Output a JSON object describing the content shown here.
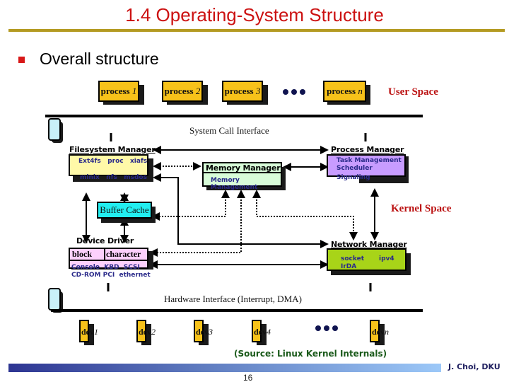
{
  "slide": {
    "title": "1.4 Operating-System Structure",
    "bullet": "Overall structure",
    "source": "(Source: Linux Kernel Internals)",
    "author": "J. Choi, DKU",
    "page_number": "16"
  },
  "colors": {
    "title": "#cc1111",
    "title_rule": "#b49a22",
    "process_box": "#f7c21a",
    "filesystem_box": "#fff9a8",
    "memory_box": "#d8fcd8",
    "process_manager_box": "#c89cff",
    "buffer_cache_box": "#22eef0",
    "device_driver_box": "#fcd0fc",
    "network_box": "#a8d418",
    "space_label": "#bb1111"
  },
  "diagram": {
    "user_space": {
      "label": "User Space",
      "processes": [
        {
          "word": "process",
          "index": "1"
        },
        {
          "word": "process",
          "index": "2"
        },
        {
          "word": "process",
          "index": "3"
        },
        {
          "word": "process",
          "index": "n"
        }
      ]
    },
    "system_call_interface": "System Call Interface",
    "kernel_space": {
      "label": "Kernel Space",
      "filesystem_manager": {
        "label": "Filesystem Manager",
        "line1": "Ext4fs   proc   xiafs",
        "line2": "minix   nfs   msdos"
      },
      "memory_manager": {
        "label": "Memory Manager",
        "line1": "Memory Management"
      },
      "process_manager": {
        "label": "Process Manager",
        "lines": [
          "Task Management",
          "Scheduler",
          "Signaling"
        ]
      },
      "buffer_cache": {
        "label": "Buffer Cache"
      },
      "device_driver": {
        "label": "Device Driver",
        "col_block": "block",
        "col_char": "character",
        "line1": "Console  KBD  SCSI",
        "line2": "CD-ROM PCI  ethernet"
      },
      "network_manager": {
        "label": "Network Manager",
        "items": [
          "socket",
          "ipv4",
          "IrDA"
        ]
      }
    },
    "hardware_interface": "Hardware Interface (Interrupt, DMA)",
    "devices": [
      {
        "word": "dev",
        "index": "1"
      },
      {
        "word": "dev",
        "index": "2"
      },
      {
        "word": "dev",
        "index": "3"
      },
      {
        "word": "dev",
        "index": "4"
      },
      {
        "word": "dev",
        "index": "n"
      }
    ]
  }
}
